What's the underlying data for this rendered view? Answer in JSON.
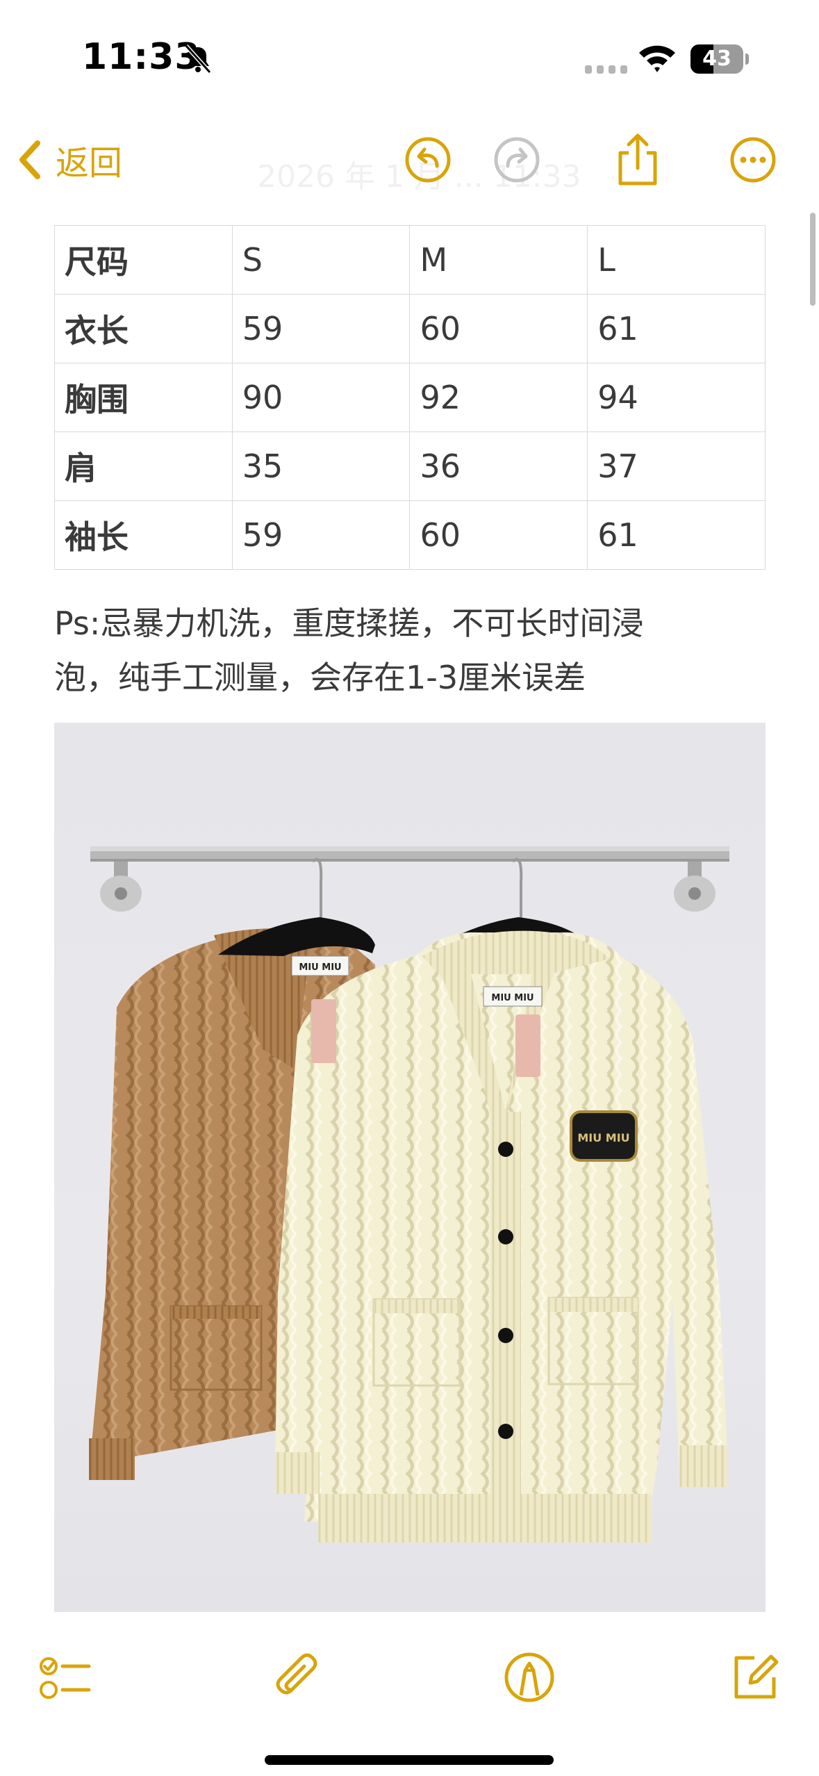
{
  "status_bar": {
    "time": "11:33",
    "battery_level": 43,
    "battery_label": "43",
    "icons": [
      "bell-slash-icon",
      "cellular-signal-icon",
      "wifi-icon",
      "battery-icon"
    ]
  },
  "nav": {
    "back_label": "返回",
    "title_ghost": "2026 年 1 月 ... 11:33",
    "buttons": [
      "undo-icon",
      "redo-icon",
      "share-icon",
      "more-icon"
    ]
  },
  "size_table": {
    "rows": [
      {
        "label": "尺码",
        "values": [
          "S",
          "M",
          "L"
        ]
      },
      {
        "label": "衣长",
        "values": [
          "59",
          "60",
          "61"
        ]
      },
      {
        "label": "胸围",
        "values": [
          "90",
          "92",
          "94"
        ]
      },
      {
        "label": "肩",
        "values": [
          "35",
          "36",
          "37"
        ]
      },
      {
        "label": "袖长",
        "values": [
          "59",
          "60",
          "61"
        ]
      }
    ]
  },
  "note": {
    "line1": "Ps:忌暴力机洗，重度揉搓，不可长时间浸",
    "line2": "泡，纯手工测量，会存在1-3厘米误差"
  },
  "photo": {
    "description_icon": "photo-cardigans",
    "tag_text": "MIU MIU"
  },
  "toolbar": {
    "buttons": [
      "checklist-icon",
      "paperclip-icon",
      "markup-pen-icon",
      "compose-icon"
    ]
  },
  "colors": {
    "accent": "#d9a40a",
    "text": "#3a3a3a",
    "camel": "#b8895a",
    "cream": "#f4f0d6"
  }
}
